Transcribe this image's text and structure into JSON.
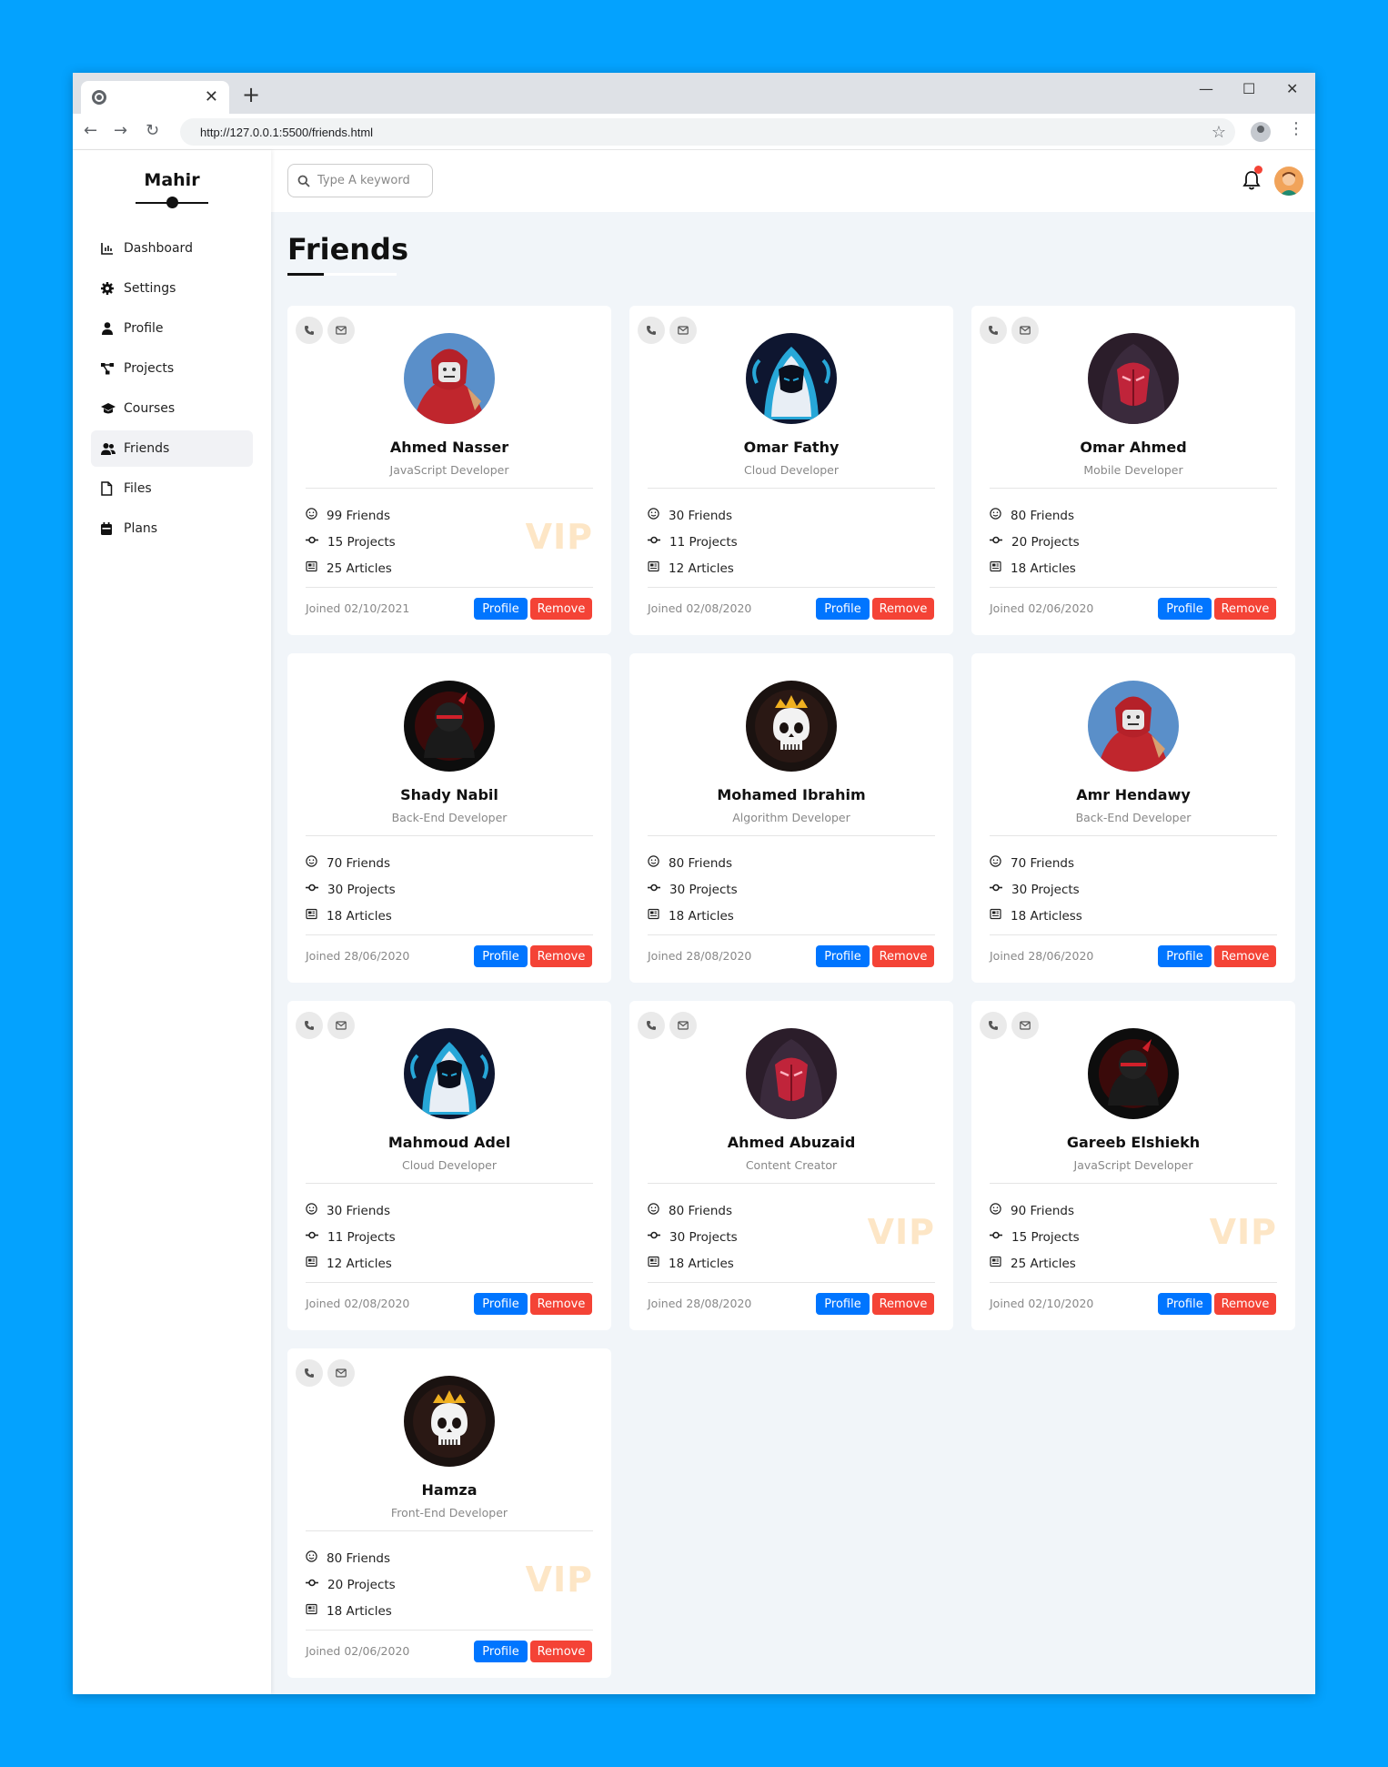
{
  "browser": {
    "url": "http://127.0.0.1:5500/friends.html"
  },
  "sidebar": {
    "brand": "Mahir",
    "items": [
      {
        "label": "Dashboard",
        "icon": "chart-icon"
      },
      {
        "label": "Settings",
        "icon": "gear-icon"
      },
      {
        "label": "Profile",
        "icon": "user-icon"
      },
      {
        "label": "Projects",
        "icon": "diagram-icon"
      },
      {
        "label": "Courses",
        "icon": "graduation-cap-icon"
      },
      {
        "label": "Friends",
        "icon": "users-icon",
        "active": true
      },
      {
        "label": "Files",
        "icon": "file-icon"
      },
      {
        "label": "Plans",
        "icon": "calendar-icon"
      }
    ]
  },
  "topbar": {
    "search_placeholder": "Type A keyword"
  },
  "page": {
    "title": "Friends"
  },
  "colors": {
    "accent": "#0075ff",
    "danger": "#f44336",
    "vip": "#fde6c6",
    "background": "#f1f5f9"
  },
  "buttons": {
    "profile": "Profile",
    "remove": "Remove"
  },
  "friends": [
    {
      "name": "Ahmed Nasser",
      "role": "JavaScript Developer",
      "friends": "99 Friends",
      "projects": "15 Projects",
      "articles": "25 Articles",
      "joined": "Joined 02/10/2021",
      "vip": "VIP",
      "contacts": true,
      "avatar": "red-hero"
    },
    {
      "name": "Omar Fathy",
      "role": "Cloud Developer",
      "friends": "30 Friends",
      "projects": "11 Projects",
      "articles": "12 Articles",
      "joined": "Joined 02/08/2020",
      "vip": "",
      "contacts": true,
      "avatar": "blue-hood"
    },
    {
      "name": "Omar Ahmed",
      "role": "Mobile Developer",
      "friends": "80 Friends",
      "projects": "20 Projects",
      "articles": "18 Articles",
      "joined": "Joined 02/06/2020",
      "vip": "",
      "contacts": true,
      "avatar": "red-mask"
    },
    {
      "name": "Shady Nabil",
      "role": "Back-End Developer",
      "friends": "70 Friends",
      "projects": "30 Projects",
      "articles": "18 Articles",
      "joined": "Joined 28/06/2020",
      "vip": "",
      "contacts": false,
      "avatar": "dark-ninja"
    },
    {
      "name": "Mohamed Ibrahim",
      "role": "Algorithm Developer",
      "friends": "80 Friends",
      "projects": "30 Projects",
      "articles": "18 Articles",
      "joined": "Joined 28/08/2020",
      "vip": "",
      "contacts": false,
      "avatar": "skull-crown"
    },
    {
      "name": "Amr Hendawy",
      "role": "Back-End Developer",
      "friends": "70 Friends",
      "projects": "30 Projects",
      "articles": "18 Articless",
      "joined": "Joined 28/06/2020",
      "vip": "",
      "contacts": false,
      "avatar": "red-hero"
    },
    {
      "name": "Mahmoud Adel",
      "role": "Cloud Developer",
      "friends": "30 Friends",
      "projects": "11 Projects",
      "articles": "12 Articles",
      "joined": "Joined 02/08/2020",
      "vip": "",
      "contacts": true,
      "avatar": "blue-hood"
    },
    {
      "name": "Ahmed Abuzaid",
      "role": "Content Creator",
      "friends": "80 Friends",
      "projects": "30 Projects",
      "articles": "18 Articles",
      "joined": "Joined 28/08/2020",
      "vip": "VIP",
      "contacts": true,
      "avatar": "red-mask"
    },
    {
      "name": "Gareeb Elshiekh",
      "role": "JavaScript Developer",
      "friends": "90 Friends",
      "projects": "15 Projects",
      "articles": "25 Articles",
      "joined": "Joined 02/10/2020",
      "vip": "VIP",
      "contacts": true,
      "avatar": "dark-ninja"
    },
    {
      "name": "Hamza",
      "role": "Front-End Developer",
      "friends": "80 Friends",
      "projects": "20 Projects",
      "articles": "18 Articles",
      "joined": "Joined 02/06/2020",
      "vip": "VIP",
      "contacts": true,
      "avatar": "skull-crown"
    }
  ]
}
